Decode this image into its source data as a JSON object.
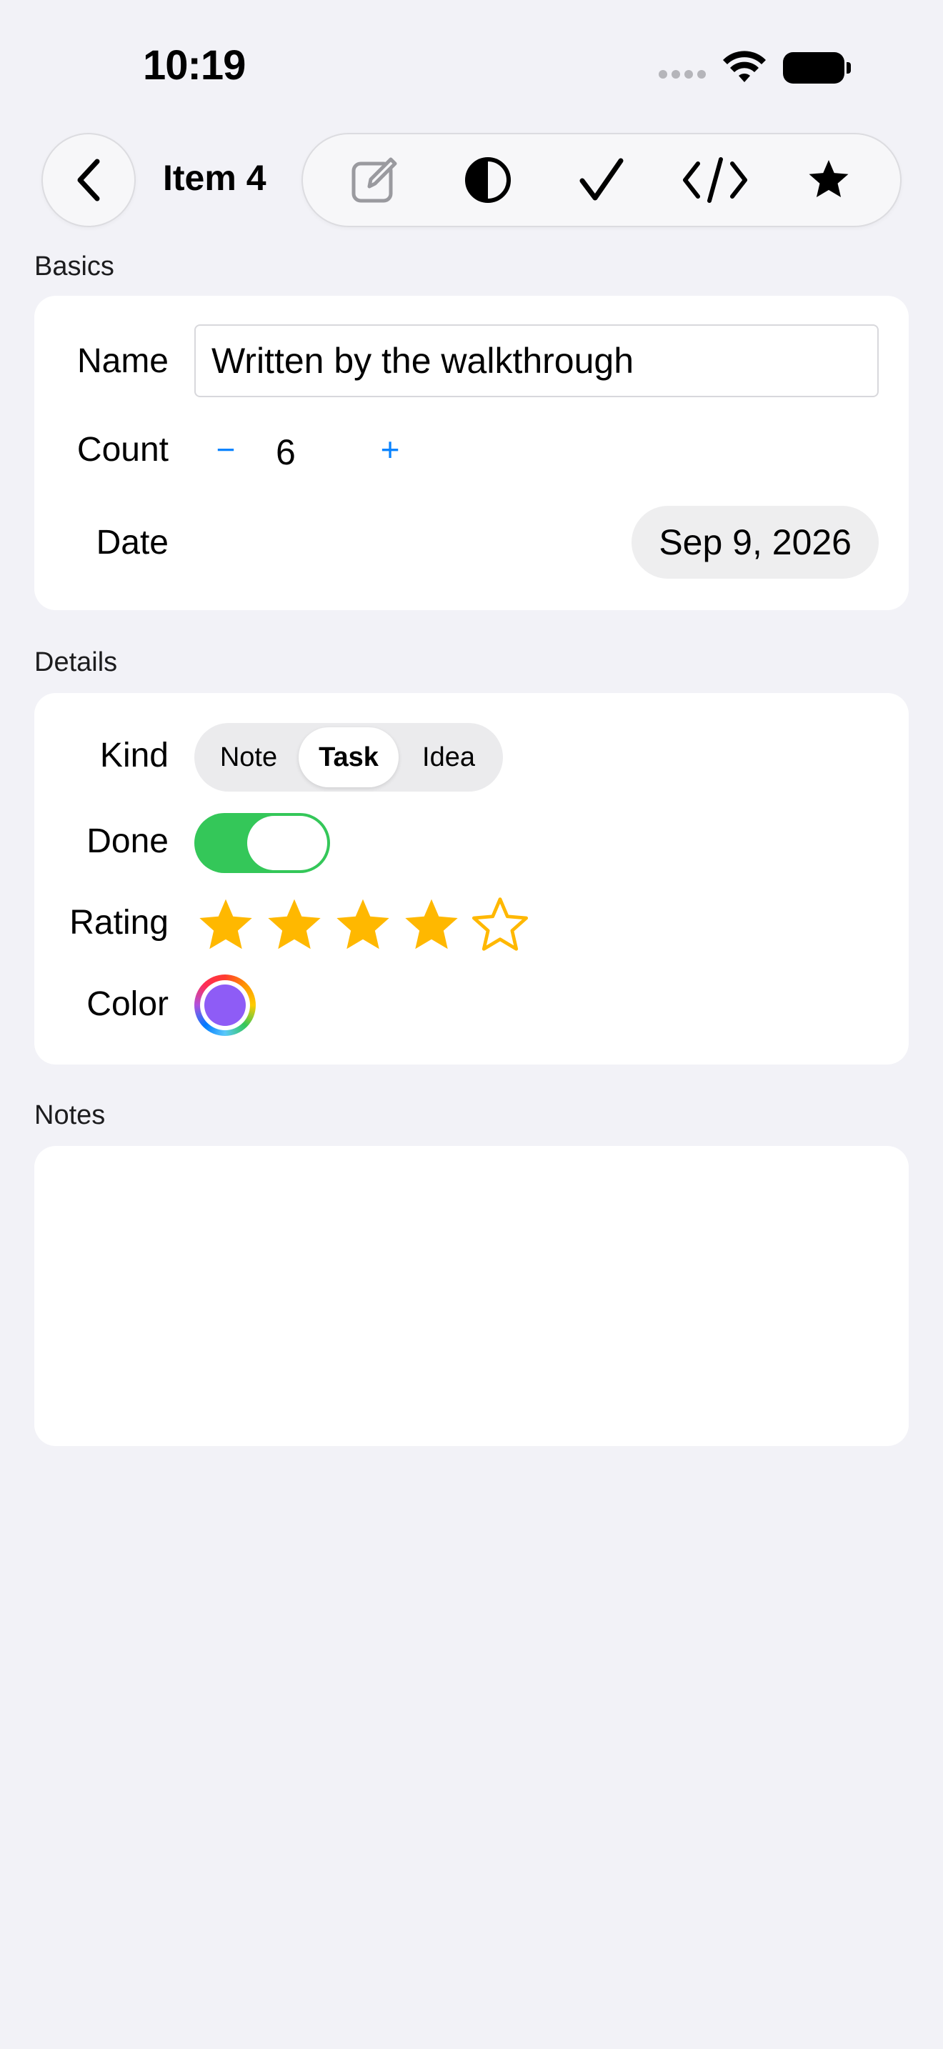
{
  "status_bar": {
    "time": "10:19"
  },
  "nav": {
    "title": "Item 4",
    "back_icon": "chevron-left-icon",
    "toolbar_icons": [
      "edit-icon",
      "contrast-icon",
      "checkmark-icon",
      "code-icon",
      "star-icon"
    ]
  },
  "basics": {
    "header": "Basics",
    "name_label": "Name",
    "name_value": "Written by the walkthrough",
    "count_label": "Count",
    "count_minus": "−",
    "count_value": "6",
    "count_plus": "+",
    "date_label": "Date",
    "date_value": "Sep 9, 2026"
  },
  "details": {
    "header": "Details",
    "kind_label": "Kind",
    "kind_options": [
      "Note",
      "Task",
      "Idea"
    ],
    "kind_selected": "Task",
    "done_label": "Done",
    "done_value": true,
    "rating_label": "Rating",
    "rating_value": 4,
    "rating_max": 5,
    "color_label": "Color",
    "color_value": "#8e5cf6"
  },
  "notes": {
    "header": "Notes",
    "value": ""
  },
  "colors": {
    "accent": "#0a84ff",
    "toggle_on": "#34c759",
    "star": "#ffb800",
    "background": "#f2f2f7"
  }
}
